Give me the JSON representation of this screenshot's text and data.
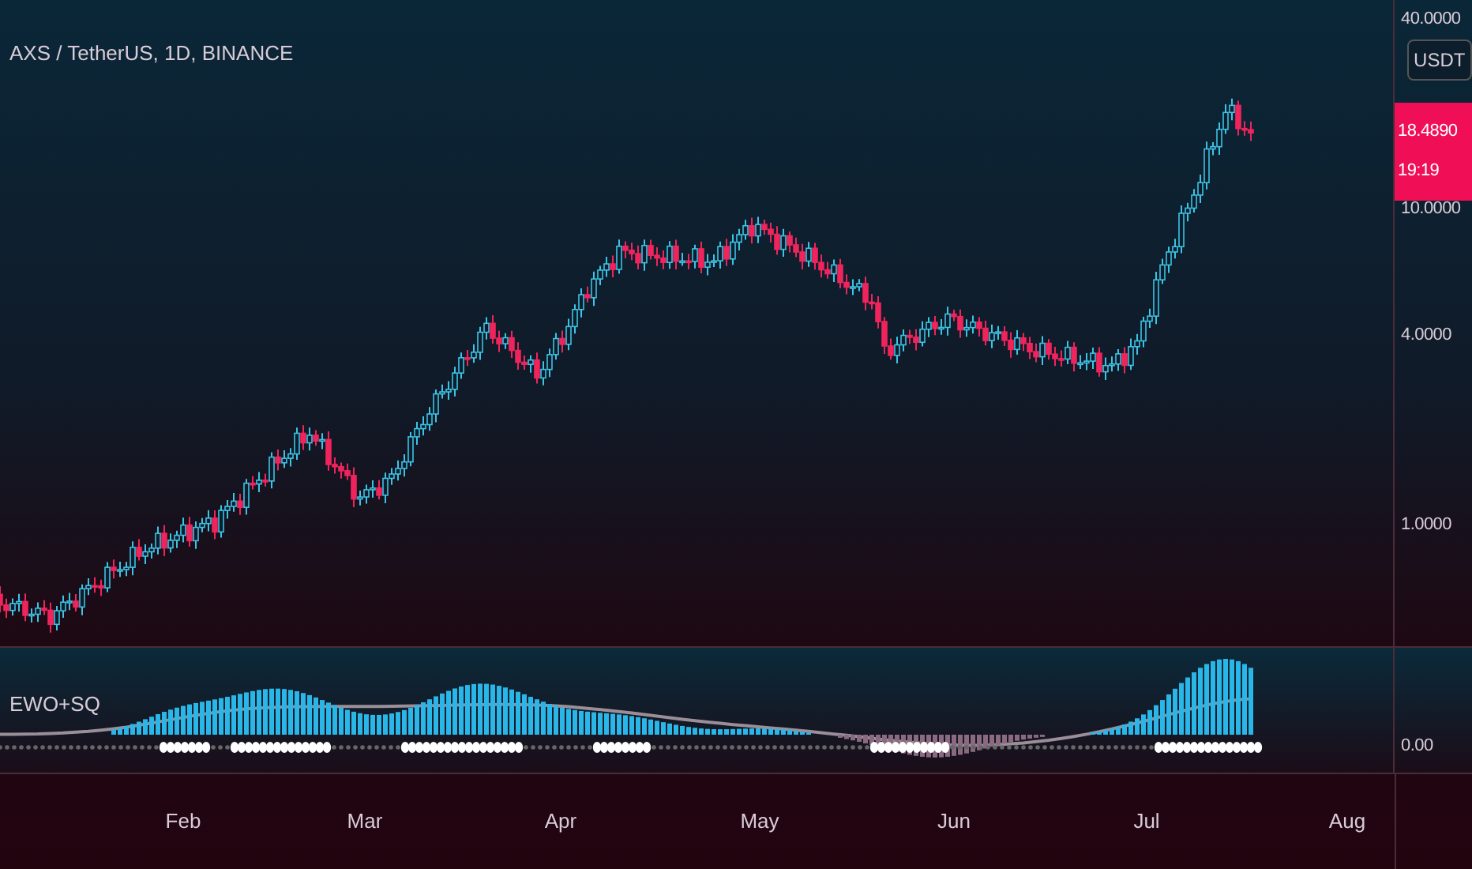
{
  "symbol_title": "AXS / TetherUS, 1D, BINANCE",
  "currency_badge": "USDT",
  "price_axis": {
    "ticks": [
      "40.0000",
      "10.0000",
      "4.0000",
      "1.0000"
    ]
  },
  "last_price": {
    "price": "18.4890",
    "countdown": "19:19"
  },
  "indicator": {
    "name": "EWO+SQ",
    "axis_ticks": [
      "0.00"
    ]
  },
  "time_axis": {
    "labels": [
      "Feb",
      "Mar",
      "Apr",
      "May",
      "Jun",
      "Jul",
      "Aug"
    ]
  }
}
